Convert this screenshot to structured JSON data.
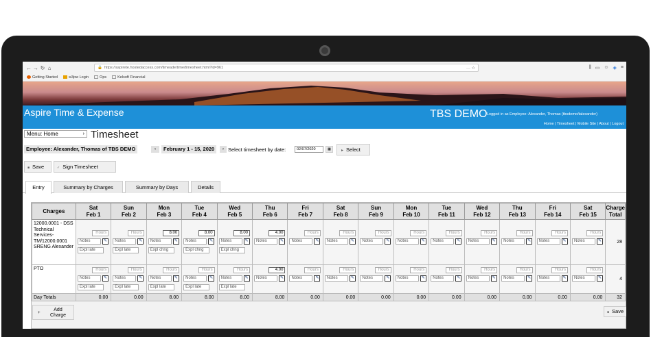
{
  "browser": {
    "url": "https://aspirete.hostedaccess.com/timeade/time/timesheet.html?id=961",
    "url_right_icons": "··· ☆",
    "bookmarks": [
      "Getting Started",
      "w3pw Login",
      "Ops",
      "Kelsoft Financial"
    ]
  },
  "header": {
    "app_title": "Aspire Time & Expense",
    "company": "TBS DEMO",
    "logged_in": "Logged in as Employee: Alexander, Thomas (tbsdemo/talexander)",
    "links": [
      "Home",
      "Timesheet",
      "Mobile Site",
      "About",
      "Logout"
    ]
  },
  "menu": {
    "label": "Menu: Home",
    "arrow": "›"
  },
  "page_title": "Timesheet",
  "employee": "Employee: Alexander, Thomas of TBS DEMO",
  "period": "February 1 - 15, 2020",
  "period_prev": "‹",
  "period_next": "›",
  "date_label": "Select timesheet by date:",
  "date_value": "02/07/2020",
  "select_label": "Select",
  "actions": {
    "save": "Save",
    "sign": "Sign Timesheet"
  },
  "tabs": [
    "Entry",
    "Summary by Charges",
    "Summary by Days",
    "Details"
  ],
  "table": {
    "charges_header": "Charges",
    "total_header": "Charge Total",
    "days": [
      {
        "dow": "Sat",
        "date": "Feb 1"
      },
      {
        "dow": "Sun",
        "date": "Feb 2"
      },
      {
        "dow": "Mon",
        "date": "Feb 3"
      },
      {
        "dow": "Tue",
        "date": "Feb 4"
      },
      {
        "dow": "Wed",
        "date": "Feb 5"
      },
      {
        "dow": "Thu",
        "date": "Feb 6"
      },
      {
        "dow": "Fri",
        "date": "Feb 7"
      },
      {
        "dow": "Sat",
        "date": "Feb 8"
      },
      {
        "dow": "Sun",
        "date": "Feb 9"
      },
      {
        "dow": "Mon",
        "date": "Feb 10"
      },
      {
        "dow": "Tue",
        "date": "Feb 11"
      },
      {
        "dow": "Wed",
        "date": "Feb 12"
      },
      {
        "dow": "Thu",
        "date": "Feb 13"
      },
      {
        "dow": "Fri",
        "date": "Feb 14"
      },
      {
        "dow": "Sat",
        "date": "Feb 15"
      }
    ],
    "placeholders": {
      "hours": "Hours",
      "notes": "Notes"
    },
    "rows": [
      {
        "charge": "12000.0001 - DSS Technical Services-TM/12000.0001 SRENG Alexander",
        "hours": [
          "",
          "",
          "8.00",
          "8.00",
          "8.00",
          "4.00",
          "",
          "",
          "",
          "",
          "",
          "",
          "",
          "",
          ""
        ],
        "expl": [
          "Expl late",
          "Expl late",
          "Expl chng",
          "Expl chng",
          "Expl chng",
          "",
          "",
          "",
          "",
          "",
          "",
          "",
          "",
          "",
          ""
        ],
        "total": "28"
      },
      {
        "charge": "PTO",
        "hours": [
          "",
          "",
          "",
          "",
          "",
          "4.00",
          "",
          "",
          "",
          "",
          "",
          "",
          "",
          "",
          ""
        ],
        "expl": [
          "Expl late",
          "Expl late",
          "Expl late",
          "Expl late",
          "Expl late",
          "",
          "",
          "",
          "",
          "",
          "",
          "",
          "",
          "",
          ""
        ],
        "total": "4"
      }
    ],
    "day_totals_label": "Day Totals",
    "day_totals": [
      "0.00",
      "0.00",
      "8.00",
      "8.00",
      "8.00",
      "8.00",
      "0.00",
      "0.00",
      "0.00",
      "0.00",
      "0.00",
      "0.00",
      "0.00",
      "0.00",
      "0.00"
    ],
    "grand_total": "32"
  },
  "add_charge": "Add Charge",
  "save_bottom": "Save"
}
